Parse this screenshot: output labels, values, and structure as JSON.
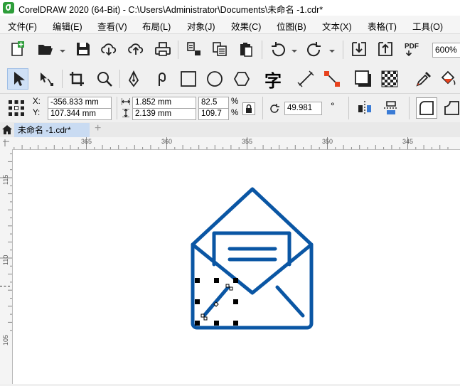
{
  "window": {
    "title": "CorelDRAW 2020 (64-Bit) - C:\\Users\\Administrator\\Documents\\未命名 -1.cdr*"
  },
  "menu": [
    {
      "label": "文件(F)",
      "key": "file"
    },
    {
      "label": "编辑(E)",
      "key": "edit"
    },
    {
      "label": "查看(V)",
      "key": "view"
    },
    {
      "label": "布局(L)",
      "key": "layout"
    },
    {
      "label": "对象(J)",
      "key": "object"
    },
    {
      "label": "效果(C)",
      "key": "effects"
    },
    {
      "label": "位图(B)",
      "key": "bitmaps"
    },
    {
      "label": "文本(X)",
      "key": "text"
    },
    {
      "label": "表格(T)",
      "key": "table"
    },
    {
      "label": "工具(O)",
      "key": "tools"
    }
  ],
  "standard_toolbar": {
    "pdf_label": "PDF",
    "zoom_value": "600%"
  },
  "toolbox": {
    "text_tool_glyph": "字"
  },
  "property_bar": {
    "x_label": "X:",
    "y_label": "Y:",
    "x_value": "-356.833 mm",
    "y_value": "107.344 mm",
    "width_value": "1.852 mm",
    "height_value": "2.139 mm",
    "scale_x": "82.5",
    "scale_y": "109.7",
    "percent": "%",
    "rotation_value": "49.981",
    "degree": "°"
  },
  "document_tab": {
    "label": "未命名 -1.cdr*",
    "add_label": "+"
  },
  "ruler": {
    "h_labels": [
      "365",
      "360",
      "355",
      "350",
      "345"
    ],
    "v_labels": [
      "115",
      "110",
      "105"
    ]
  },
  "colors": {
    "envelope_stroke": "#0a56a4",
    "tab_active": "#c9dbf2"
  }
}
